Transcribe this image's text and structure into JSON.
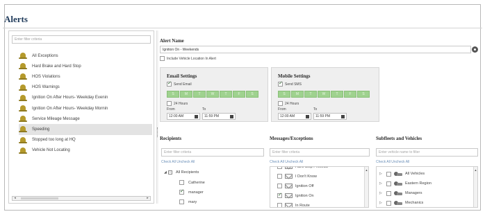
{
  "window": {
    "title": "Alerts"
  },
  "sidebar": {
    "filter_placeholder": "Enter filter criteria",
    "alerts": [
      "All Exceptions",
      "Hard Brake and Hard Stop",
      "HOS Violations",
      "HOS Warnings",
      "Ignition On After Hours- Weekday Evenin",
      "Ignition On After Hours- Weekday Mornin",
      "Service Mileage Message",
      "Speeding",
      "Stopped too long at HQ",
      "Vehicle Not Locating"
    ],
    "selected_alert": "Speeding"
  },
  "detail": {
    "alert_name_title": "Alert Name",
    "alert_name_value": "Ignition On - Weekends",
    "include_location_label": "Include Vehicle Location In Alert",
    "include_location_checked": false,
    "email": {
      "title": "Email Settings",
      "send_label": "Send Email",
      "send_checked": true,
      "days": [
        "S",
        "M",
        "T",
        "W",
        "T",
        "F",
        "S"
      ],
      "hours24_label": "24 Hours",
      "hours24_checked": false,
      "from_label": "From",
      "to_label": "To",
      "from_time": "12:00 AM",
      "to_time": "11:59 PM"
    },
    "mobile": {
      "title": "Mobile Settings",
      "send_label": "Send SMS",
      "send_checked": true,
      "days": [
        "S",
        "M",
        "T",
        "W",
        "T",
        "F",
        "S"
      ],
      "hours24_label": "24 Hours",
      "hours24_checked": false,
      "from_label": "From",
      "to_label": "To",
      "from_time": "12:00 AM",
      "to_time": "11:59 PM"
    }
  },
  "recipients": {
    "title": "Recipients",
    "filter_placeholder": "Enter filter criteria",
    "check_links": "Check All Uncheck All",
    "root_label": "All Recipients",
    "items": [
      {
        "label": "Catherine",
        "checked": false
      },
      {
        "label": "manager",
        "checked": true
      },
      {
        "label": "mary",
        "checked": false
      }
    ]
  },
  "messages": {
    "title": "Messages/Exceptions",
    "filter_placeholder": "Enter filter criteria",
    "check_links": "Check All Uncheck All",
    "items": [
      {
        "label": "Hard Stop Procedu",
        "checked": false
      },
      {
        "label": "I Don't Know",
        "checked": false
      },
      {
        "label": "Ignition Off",
        "checked": false
      },
      {
        "label": "Ignition On",
        "checked": true
      },
      {
        "label": "In Route",
        "checked": false
      }
    ]
  },
  "vehicles": {
    "title": "Subfleets and Vehicles",
    "filter_placeholder": "Enter vehicle name to filter",
    "check_links": "Check All Uncheck All",
    "items": [
      {
        "label": "All Vehicles",
        "checked": false
      },
      {
        "label": "Eastern Region",
        "checked": false
      },
      {
        "label": "Managers",
        "checked": false
      },
      {
        "label": "Mechanics",
        "checked": false
      }
    ]
  },
  "colors": {
    "title_blue": "#1f3a5a",
    "day_green": "#9fd28f",
    "link_blue": "#6b8fb8",
    "selected_row": "#e3e3e3"
  }
}
